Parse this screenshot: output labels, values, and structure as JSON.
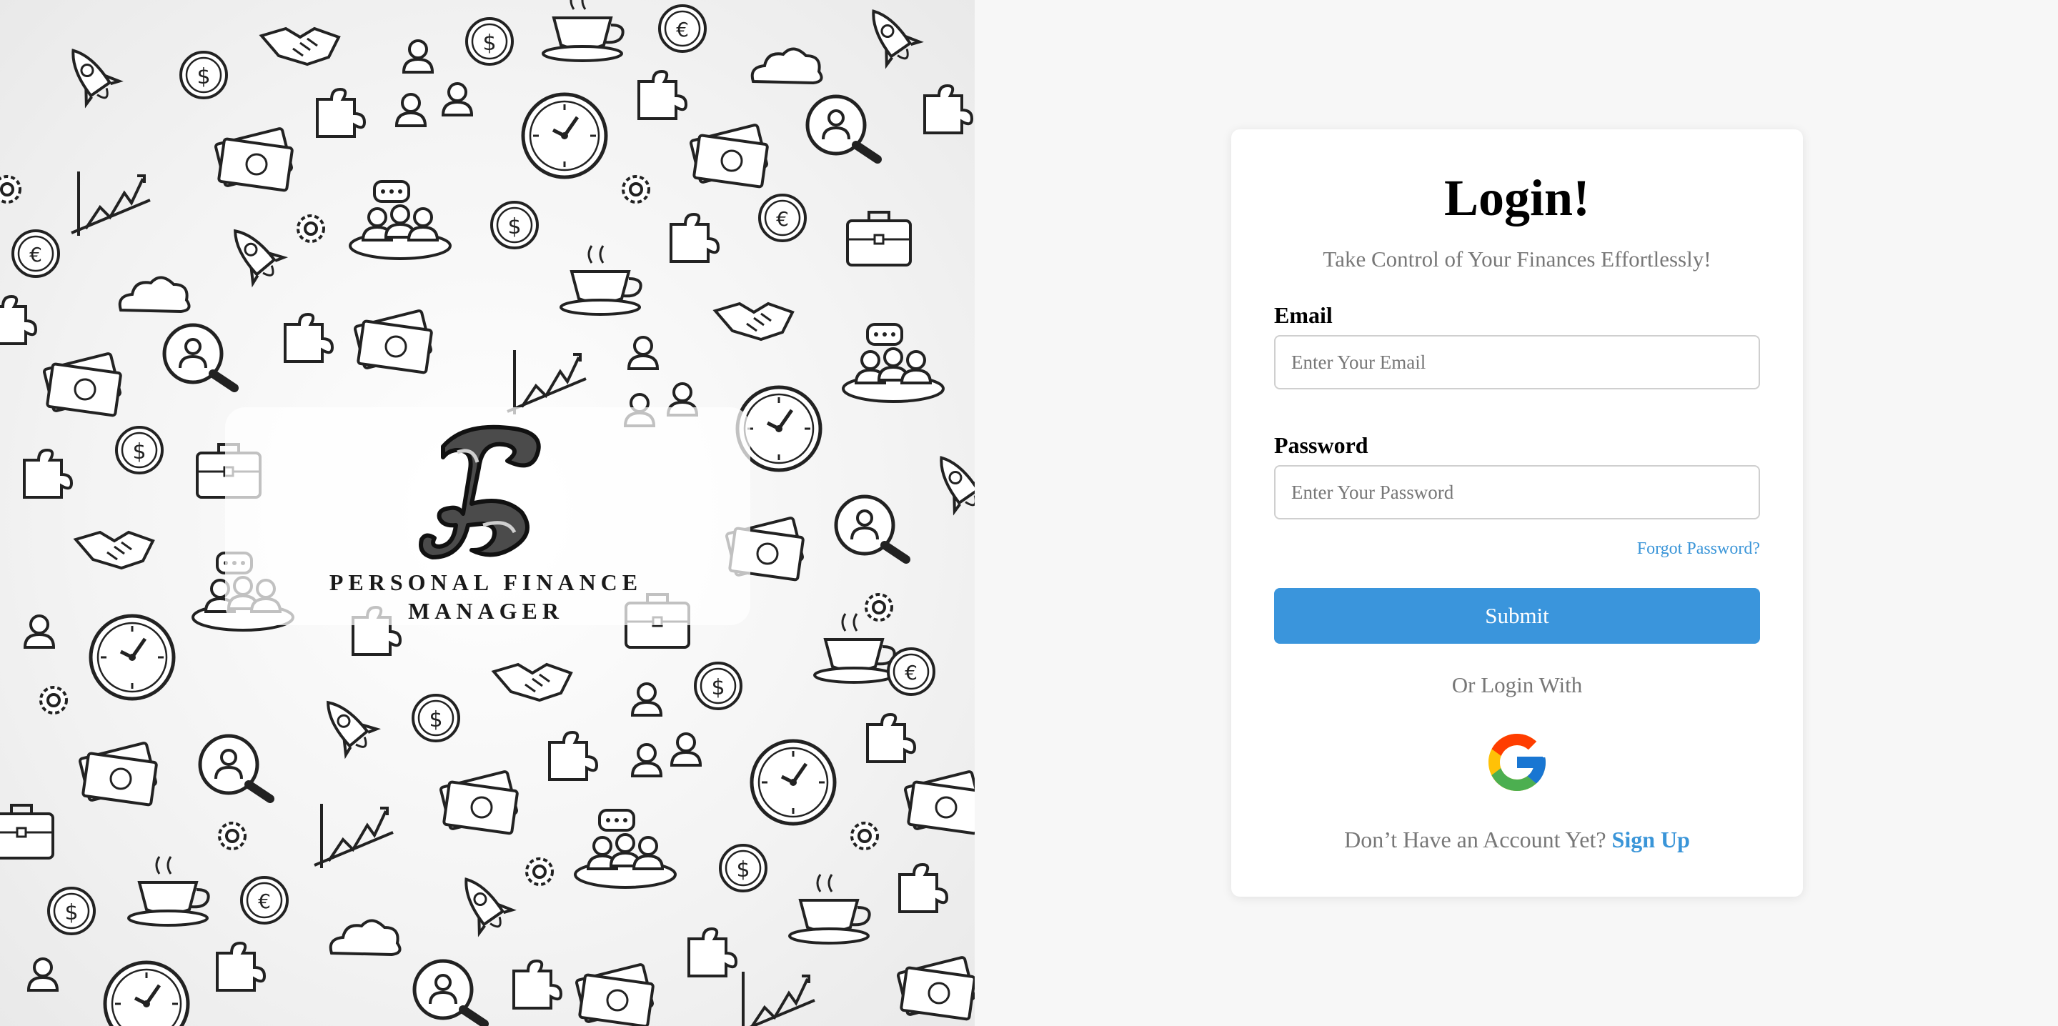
{
  "branding": {
    "logo_letter": "F",
    "logo_text_line1": "PERSONAL FINANCE",
    "logo_text_line2": "MANAGER"
  },
  "login": {
    "title": "Login!",
    "subtitle": "Take Control of Your Finances Effortlessly!",
    "email_label": "Email",
    "email_placeholder": "Enter Your Email",
    "email_value": "",
    "password_label": "Password",
    "password_placeholder": "Enter Your Password",
    "password_value": "",
    "forgot_password": "Forgot Password?",
    "submit_label": "Submit",
    "or_login_with": "Or Login With",
    "google_icon": "google-logo",
    "no_account_text": "Don’t Have an Account Yet?",
    "signup_label": "Sign Up"
  },
  "colors": {
    "accent": "#3a95dc",
    "page_background": "#f7f7f7",
    "card_background": "#ffffff",
    "muted_text": "#777777"
  }
}
